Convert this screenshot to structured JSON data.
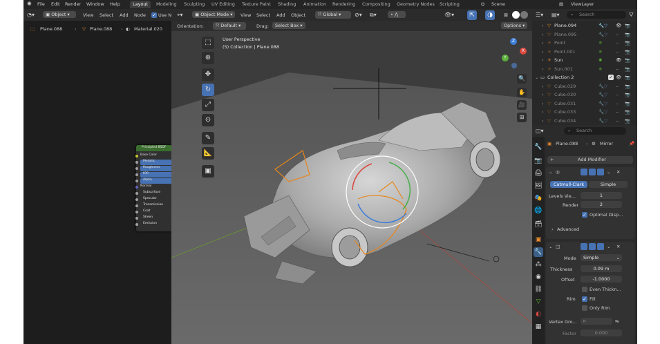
{
  "topbar": {
    "menus": [
      "File",
      "Edit",
      "Render",
      "Window",
      "Help"
    ],
    "workspaces": [
      "Layout",
      "Modeling",
      "Sculpting",
      "UV Editing",
      "Texture Paint",
      "Shading",
      "Animation",
      "Rendering",
      "Compositing",
      "Geometry Nodes",
      "Scripting"
    ],
    "active_workspace": "Layout",
    "scene": "Scene",
    "view_layer": "ViewLayer"
  },
  "node_editor": {
    "mode": "Object",
    "menus": [
      "View",
      "Select",
      "Add",
      "Node"
    ],
    "use_nodes": "Use N",
    "breadcrumb": [
      "Plane.088",
      "Plane.088",
      "Material.020"
    ],
    "node": {
      "title": "Principled BSDF",
      "rows": [
        "Base Color",
        "Metallic",
        "Roughness",
        "IOR",
        "Alpha",
        "Normal",
        "Subsurface",
        "Specular",
        "Transmission",
        "Coat",
        "Sheen",
        "Emission"
      ]
    }
  },
  "viewport": {
    "mode": "Object Mode",
    "menus": [
      "View",
      "Select",
      "Add",
      "Object"
    ],
    "transform": "Global",
    "orientation_label": "Orientation:",
    "orientation_value": "Default",
    "drag_label": "Drag:",
    "drag_value": "Select Box",
    "options": "Options",
    "overlay_title": "User Perspective",
    "overlay_sub": "(5) Collection | Plane.088",
    "gizmo": {
      "x": "X",
      "y": "Y",
      "z": "Z"
    }
  },
  "outliner": {
    "search_placeholder": "Search",
    "rows": [
      {
        "name": "Plane.094",
        "type": "mesh",
        "dim": false
      },
      {
        "name": "Plane.095",
        "type": "mesh",
        "dim": true
      },
      {
        "name": "Point",
        "type": "light",
        "dim": true
      },
      {
        "name": "Point.001",
        "type": "light",
        "dim": true
      },
      {
        "name": "Sun",
        "type": "light",
        "dim": false
      },
      {
        "name": "Sun.001",
        "type": "light",
        "dim": true
      },
      {
        "name": "Collection 2",
        "type": "collection",
        "dim": false
      },
      {
        "name": "Cube.029",
        "type": "mesh",
        "dim": true
      },
      {
        "name": "Cube.030",
        "type": "mesh",
        "dim": true
      },
      {
        "name": "Cube.031",
        "type": "mesh",
        "dim": true
      },
      {
        "name": "Cube.033",
        "type": "mesh",
        "dim": true
      },
      {
        "name": "Cube.034",
        "type": "mesh",
        "dim": true
      }
    ]
  },
  "properties": {
    "search_placeholder": "Search",
    "object": "Plane.088",
    "modifier_crumb": "Mirror",
    "add_modifier": "Add Modifier",
    "subsurf": {
      "tab_catmull": "Catmull-Clark",
      "tab_simple": "Simple",
      "levels_label": "Levels Vie...",
      "levels_value": "1",
      "render_label": "Render",
      "render_value": "2",
      "optimal": "Optimal Disp...",
      "advanced": "Advanced"
    },
    "solidify": {
      "mode_label": "Mode",
      "mode_value": "Simple",
      "thickness_label": "Thickness",
      "thickness_value": "0.09 m",
      "offset_label": "Offset",
      "offset_value": "-1.0000",
      "even": "Even Thickn...",
      "rim_label": "Rim",
      "fill": "Fill",
      "only_rim": "Only Rim",
      "vgroup_label": "Vertex Gro...",
      "factor_label": "Factor",
      "factor_value": "0.000"
    }
  }
}
